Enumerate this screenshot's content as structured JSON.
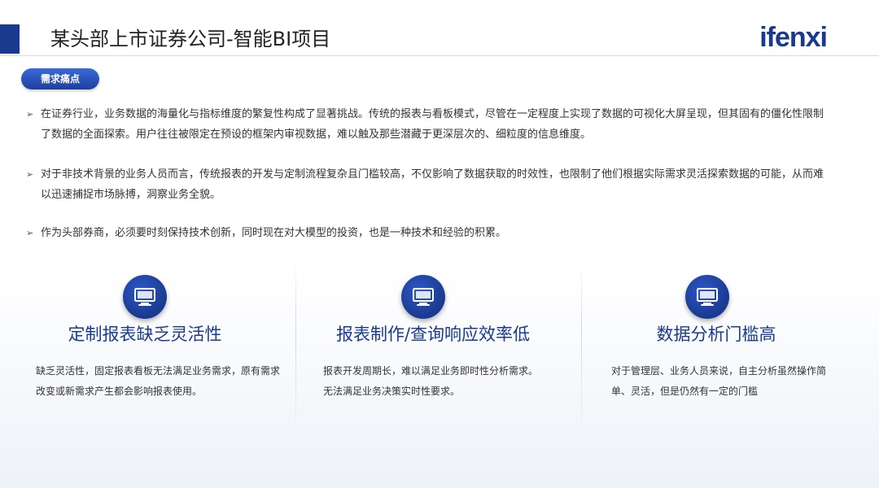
{
  "header": {
    "title": "某头部上市证券公司-智能BI项目",
    "logo_text": "ifenxi",
    "accent_color": "#1a3a8f"
  },
  "section": {
    "label": "需求痛点"
  },
  "bullets": [
    {
      "text": "在证券行业，业务数据的海量化与指标维度的繁复性构成了显著挑战。传统的报表与看板模式，尽管在一定程度上实现了数据的可视化大屏呈现，但其固有的僵化性限制了数据的全面探索。用户往往被限定在预设的框架内审视数据，难以触及那些潜藏于更深层次的、细粒度的信息维度。"
    },
    {
      "text": "对于非技术背景的业务人员而言，传统报表的开发与定制流程复杂且门槛较高，不仅影响了数据获取的时效性，也限制了他们根据实际需求灵活探索数据的可能，从而难以迅速捕捉市场脉搏，洞察业务全貌。"
    },
    {
      "text": "作为头部券商，必须要时刻保持技术创新，同时现在对大模型的投资，也是一种技术和经验的积累。"
    }
  ],
  "bullet_marker": "➢",
  "columns": [
    {
      "icon": "monitor-icon",
      "title": "定制报表缺乏灵活性",
      "desc": "缺乏灵活性，固定报表看板无法满足业务需求，原有需求改变或新需求产生都会影响报表使用。"
    },
    {
      "icon": "monitor-icon",
      "title": "报表制作/查询响应效率低",
      "desc": "报表开发周期长，难以满足业务即时性分析需求。无法满足业务决策实时性要求。"
    },
    {
      "icon": "monitor-icon",
      "title": "数据分析门槛高",
      "desc": "对于管理层、业务人员来说，自主分析虽然操作简单、灵活，但是仍然有一定的门槛"
    }
  ]
}
